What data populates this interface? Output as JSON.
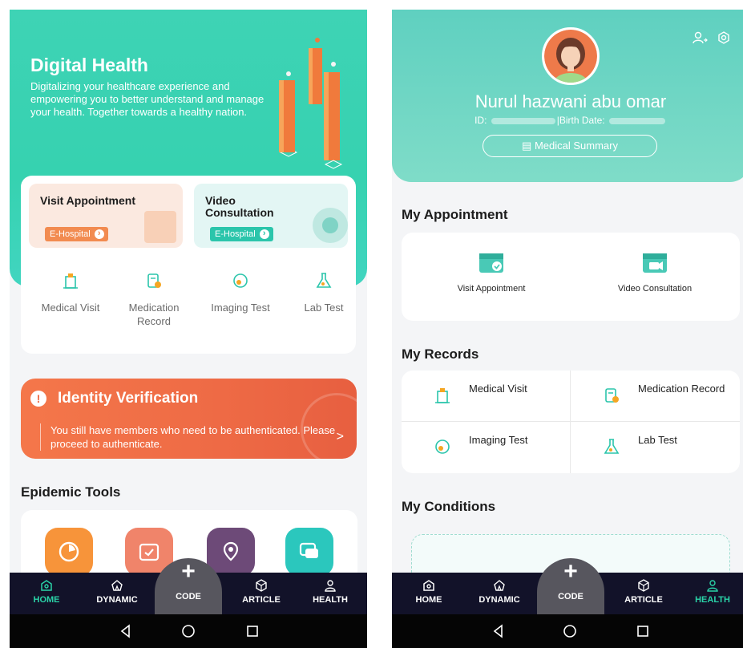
{
  "left": {
    "hero": {
      "title": "Digital Health",
      "description": "Digitalizing your healthcare experience and empowering you to better understand and manage your health. Together towards a healthy nation."
    },
    "services": {
      "visit_title": "Visit Appointment",
      "visit_tag": "E-Hospital",
      "video_title": "Video Consultation",
      "video_tag": "E-Hospital"
    },
    "records": [
      {
        "label": "Medical Visit",
        "icon": "hospital-icon"
      },
      {
        "label": "Medication Record",
        "icon": "medication-icon"
      },
      {
        "label": "Imaging Test",
        "icon": "imaging-icon"
      },
      {
        "label": "Lab Test",
        "icon": "flask-icon"
      }
    ],
    "identity": {
      "title": "Identity Verification",
      "text": "You still have members who need to be authenticated. Please proceed to authenticate.",
      "arrow": ">"
    },
    "epidemic_title": "Epidemic Tools",
    "tools": [
      {
        "icon": "radar-icon",
        "color": "#f7943a"
      },
      {
        "icon": "calendar-check-icon",
        "color": "#f0846a"
      },
      {
        "icon": "map-pin-icon",
        "color": "#6d4a78"
      },
      {
        "icon": "chat-icon",
        "color": "#2bc7bd"
      }
    ]
  },
  "right": {
    "profile": {
      "name": "Nurul hazwani abu omar",
      "id_label": "ID:",
      "birth_label": "|Birth Date:",
      "summary_button": "Medical Summary"
    },
    "appointment_title": "My Appointment",
    "appointments": [
      {
        "label": "Visit Appointment"
      },
      {
        "label": "Video Consultation"
      }
    ],
    "records_title": "My Records",
    "records": [
      {
        "label": "Medical Visit"
      },
      {
        "label": "Medication Record"
      },
      {
        "label": "Imaging Test"
      },
      {
        "label": "Lab Test"
      }
    ],
    "conditions_title": "My Conditions"
  },
  "nav": {
    "home": "HOME",
    "dynamic": "DYNAMIC",
    "code": "CODE",
    "article": "ARTICLE",
    "health": "HEALTH",
    "code_symbol": "+"
  },
  "colors": {
    "accent": "#2ad3a8",
    "hero": "#3ed3b5",
    "alert": "#ee6a45",
    "nav_bg": "#121229"
  }
}
